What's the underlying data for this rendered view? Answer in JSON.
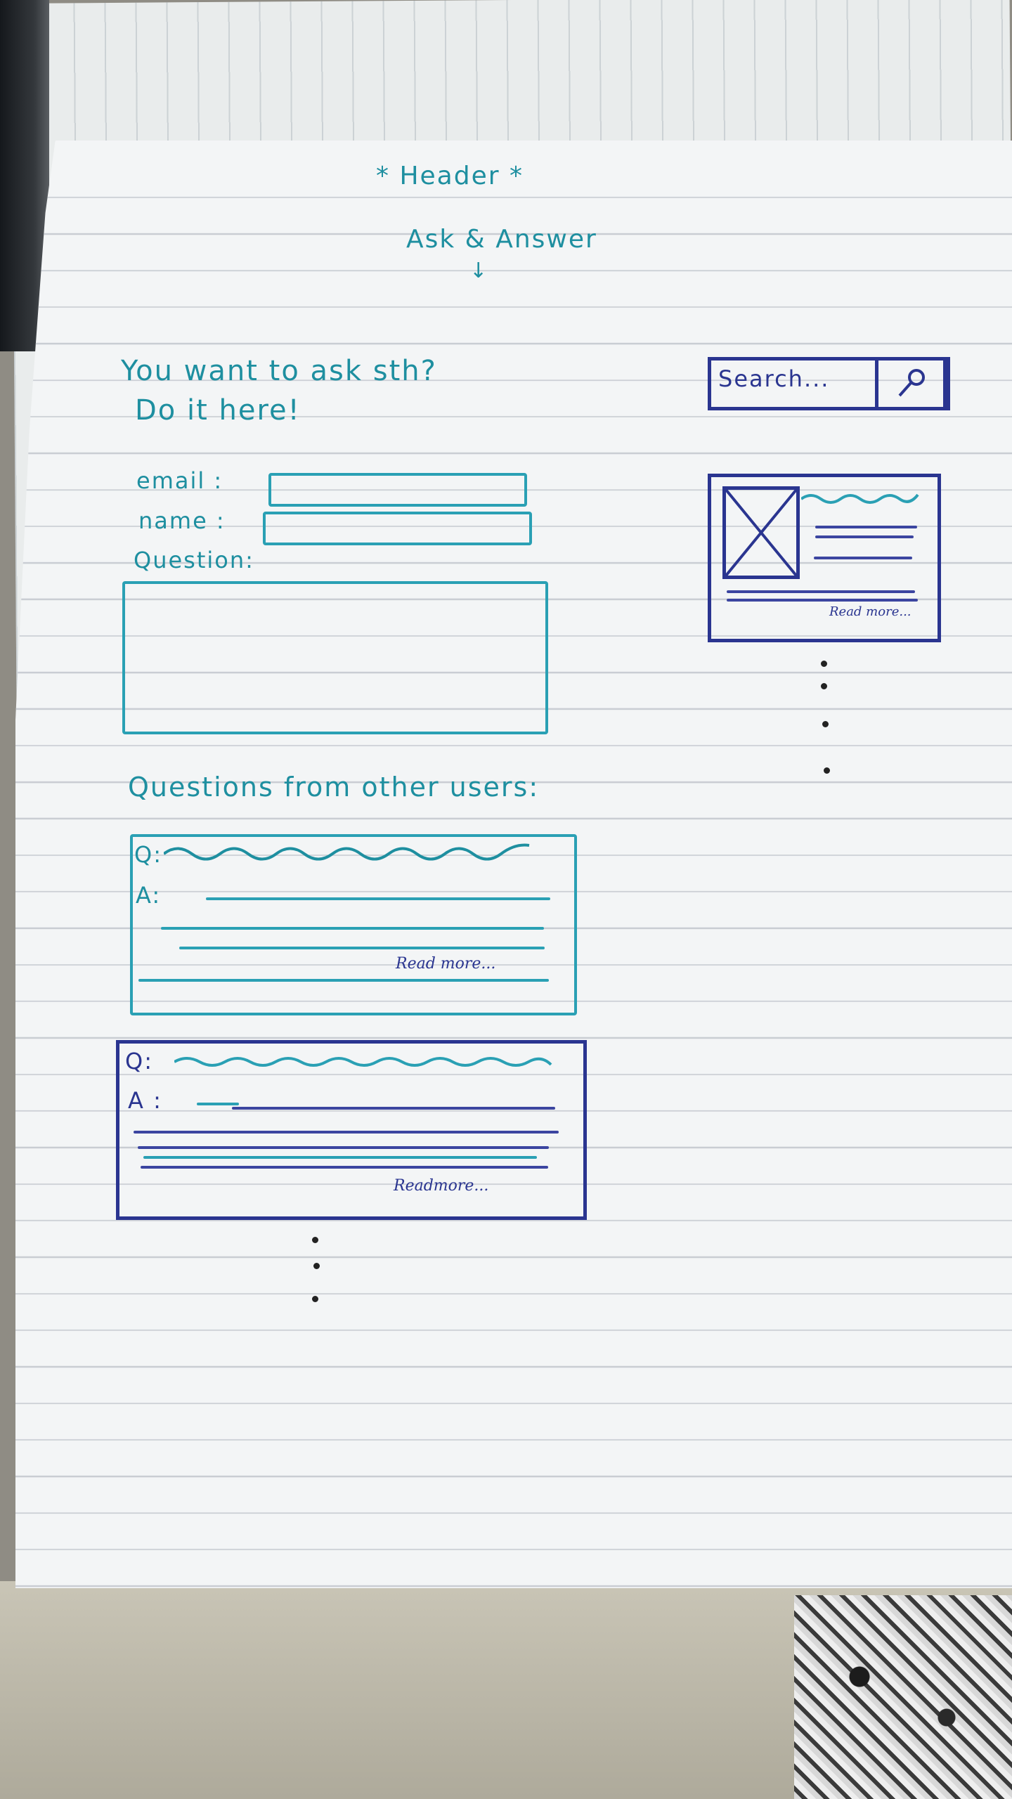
{
  "header": {
    "title": "* Header *",
    "subtitle": "Ask & Answer",
    "arrow": "↓"
  },
  "ask_form": {
    "title_line1": "You want to ask sth?",
    "title_line2": "Do it here!",
    "email_label": "email :",
    "name_label": "name :",
    "question_label": "Question:"
  },
  "questions_section": {
    "title": "Questions from other users:",
    "cards": [
      {
        "q_label": "Q:",
        "a_label": "A:",
        "read_more": "Read more..."
      },
      {
        "q_label": "Q:",
        "a_label": "A :",
        "read_more": "Readmore..."
      }
    ]
  },
  "sidebar": {
    "search_placeholder": "Search...",
    "search_icon": "magnifier-icon",
    "card_read_more": "Read more..."
  },
  "colors": {
    "teal_ink": "#1e8fa0",
    "blue_ink": "#2a3590",
    "paper": "#f3f5f6"
  }
}
